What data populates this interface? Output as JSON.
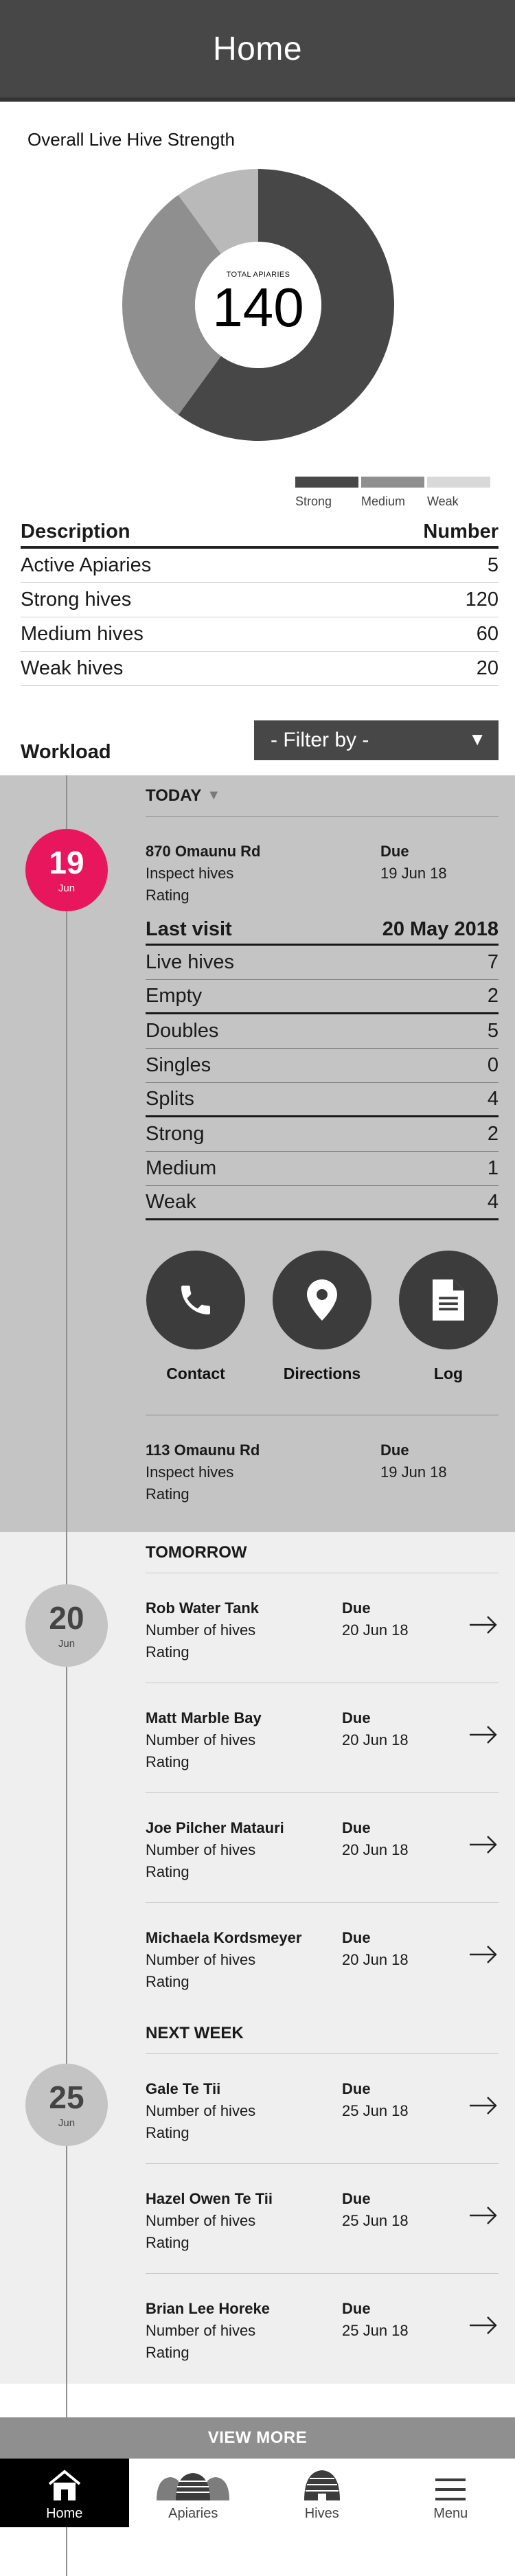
{
  "header": {
    "title": "Home"
  },
  "strength": {
    "title": "Overall Live Hive Strength",
    "center_label": "TOTAL APIARIES",
    "center_value": "140",
    "legend": [
      {
        "label": "Strong",
        "color": "#474747"
      },
      {
        "label": "Medium",
        "color": "#8f8f8f"
      },
      {
        "label": "Weak",
        "color": "#d9d9d9"
      }
    ]
  },
  "chart_data": {
    "type": "pie",
    "title": "Overall Live Hive Strength",
    "categories": [
      "Strong",
      "Medium",
      "Weak"
    ],
    "values": [
      120,
      60,
      20
    ],
    "colors": [
      "#474747",
      "#8f8f8f",
      "#b9b9b9"
    ]
  },
  "summary": {
    "header_left": "Description",
    "header_right": "Number",
    "rows": [
      {
        "label": "Active Apiaries",
        "value": "5"
      },
      {
        "label": "Strong hives",
        "value": "120"
      },
      {
        "label": "Medium hives",
        "value": "60"
      },
      {
        "label": "Weak hives",
        "value": "20"
      }
    ]
  },
  "workload": {
    "title": "Workload",
    "filter_label": "- Filter by  -",
    "filter_arrow": "▼"
  },
  "today": {
    "label": "TODAY",
    "label_arrow": "▼",
    "day": "19",
    "month": "Jun",
    "tasks": [
      {
        "place": "870 Omaunu Rd",
        "line1": "Inspect hives",
        "line2": "Rating",
        "due_label": "Due",
        "due_date": "19 Jun 18"
      },
      {
        "place": "113 Omaunu Rd",
        "line1": "Inspect hives",
        "line2": "Rating",
        "due_label": "Due",
        "due_date": "19 Jun 18"
      }
    ],
    "last_visit": {
      "label": "Last visit",
      "date": "20 May 2018",
      "rows": [
        {
          "label": "Live hives",
          "value": "7"
        },
        {
          "label": "Empty",
          "value": "2"
        },
        {
          "label": "Doubles",
          "value": "5"
        },
        {
          "label": "Singles",
          "value": "0"
        },
        {
          "label": "Splits",
          "value": "4"
        },
        {
          "label": "Strong",
          "value": "2"
        },
        {
          "label": "Medium",
          "value": "1"
        },
        {
          "label": "Weak",
          "value": "4"
        }
      ]
    },
    "actions": [
      {
        "label": "Contact",
        "icon": "phone-icon"
      },
      {
        "label": "Directions",
        "icon": "map-pin-icon"
      },
      {
        "label": "Log",
        "icon": "document-icon"
      }
    ]
  },
  "tomorrow": {
    "label": "TOMORROW",
    "day": "20",
    "month": "Jun",
    "tasks": [
      {
        "place": "Rob Water Tank",
        "line1": "Number of hives",
        "line2": "Rating",
        "due_label": "Due",
        "due_date": "20 Jun 18"
      },
      {
        "place": "Matt Marble Bay",
        "line1": "Number of hives",
        "line2": "Rating",
        "due_label": "Due",
        "due_date": "20 Jun 18"
      },
      {
        "place": "Joe Pilcher Matauri",
        "line1": "Number of hives",
        "line2": "Rating",
        "due_label": "Due",
        "due_date": "20 Jun 18"
      },
      {
        "place": "Michaela Kordsmeyer",
        "line1": "Number of hives",
        "line2": "Rating",
        "due_label": "Due",
        "due_date": "20 Jun 18"
      }
    ]
  },
  "next_week": {
    "label": "NEXT WEEK",
    "day": "25",
    "month": "Jun",
    "tasks": [
      {
        "place": "Gale Te Tii",
        "line1": "Number of hives",
        "line2": "Rating",
        "due_label": "Due",
        "due_date": "25 Jun 18"
      },
      {
        "place": "Hazel Owen Te Tii",
        "line1": "Number of hives",
        "line2": "Rating",
        "due_label": "Due",
        "due_date": "25 Jun 18"
      },
      {
        "place": "Brian Lee Horeke",
        "line1": "Number of hives",
        "line2": "Rating",
        "due_label": "Due",
        "due_date": "25 Jun 18"
      }
    ]
  },
  "view_more": "VIEW MORE",
  "nav": [
    {
      "label": "Home",
      "icon": "home-icon",
      "active": true
    },
    {
      "label": "Apiaries",
      "icon": "apiaries-icon",
      "active": false
    },
    {
      "label": "Hives",
      "icon": "hive-icon",
      "active": false
    },
    {
      "label": "Menu",
      "icon": "menu-icon",
      "active": false
    }
  ]
}
